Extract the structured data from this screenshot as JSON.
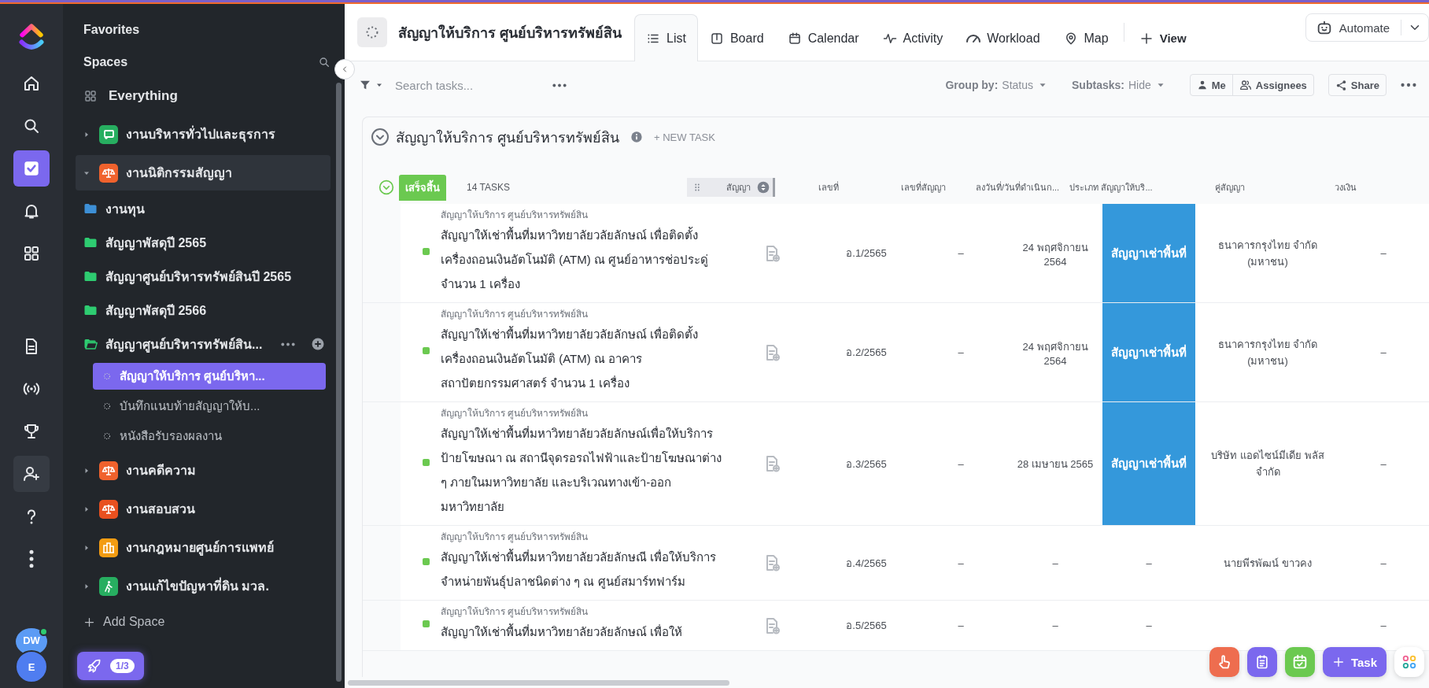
{
  "rail": {
    "items": [
      {
        "kind": "home",
        "selected": false,
        "hovered": false
      },
      {
        "kind": "search",
        "selected": false,
        "hovered": false
      },
      {
        "kind": "tasks",
        "selected": true,
        "hovered": false
      },
      {
        "kind": "bell",
        "selected": false,
        "hovered": false
      },
      {
        "kind": "grid",
        "selected": false,
        "hovered": false
      },
      {
        "kind": "gap"
      },
      {
        "kind": "doc",
        "selected": false,
        "hovered": false
      },
      {
        "kind": "pulse",
        "selected": false,
        "hovered": false
      },
      {
        "kind": "trophy",
        "selected": false,
        "hovered": false
      },
      {
        "kind": "invite",
        "selected": false,
        "hovered": true
      },
      {
        "kind": "help",
        "selected": false,
        "hovered": false
      },
      {
        "kind": "more",
        "selected": false,
        "hovered": false
      }
    ],
    "avatars": [
      {
        "initials": "DW",
        "online": true
      },
      {
        "initials": "E",
        "online": false
      }
    ]
  },
  "sidebar": {
    "favorites": "Favorites",
    "spaces_label": "Spaces",
    "everything": "Everything",
    "spaces": [
      {
        "label": "งานบริหารทั่วไปและธุรการ",
        "kind": "presentation",
        "color": "#27ae60",
        "expanded": false,
        "selected": false
      },
      {
        "label": "งานนิติกรรมสัญญา",
        "kind": "scale",
        "color": "#f0622d",
        "expanded": true,
        "selected": true,
        "children": [
          {
            "label": "งานทุน",
            "color": "#3d8fd6",
            "expanded": false
          },
          {
            "label": "สัญญาพัสดุปี 2565",
            "color": "#2ecc71",
            "expanded": false
          },
          {
            "label": "สัญญาศูนย์บริหารทรัพย์สินปี 2565",
            "color": "#2ecc71",
            "expanded": false
          },
          {
            "label": "สัญญาพัสดุปี 2566",
            "color": "#2ecc71",
            "expanded": false
          },
          {
            "label": "สัญญาศูนย์บริหารทรัพย์สิน...",
            "color": "#2ecc71",
            "expanded": true,
            "children": [
              {
                "label": "สัญญาให้บริการ ศูนย์บริหา...",
                "selected": true
              },
              {
                "label": "บันทึกแนบท้ายสัญญาให้บ...",
                "selected": false
              },
              {
                "label": "หนังสือรับรองผลงาน",
                "selected": false
              }
            ]
          }
        ]
      },
      {
        "label": "งานคดีความ",
        "kind": "scale",
        "color": "#f0622d",
        "expanded": false,
        "selected": false
      },
      {
        "label": "งานสอบสวน",
        "kind": "scale",
        "color": "#e8501f",
        "expanded": false,
        "selected": false
      },
      {
        "label": "งานกฎหมายศูนย์การแพทย์",
        "kind": "building",
        "color": "#f39c12",
        "expanded": false,
        "selected": false
      },
      {
        "label": "งานแก้ไขปัญหาที่ดิน มวล.",
        "kind": "walker",
        "color": "#27ae60",
        "expanded": false,
        "selected": false
      }
    ],
    "add_space": "Add Space",
    "onboarding": "1/3"
  },
  "header": {
    "title": "สัญญาให้บริการ ศูนย์บริหารทรัพย์สิน",
    "tabs": [
      {
        "label": "List",
        "kind": "list",
        "selected": true
      },
      {
        "label": "Board",
        "kind": "board",
        "selected": false
      },
      {
        "label": "Calendar",
        "kind": "calendar",
        "selected": false
      },
      {
        "label": "Activity",
        "kind": "activity",
        "selected": false
      },
      {
        "label": "Workload",
        "kind": "gauge",
        "selected": false
      },
      {
        "label": "Map",
        "kind": "pin",
        "selected": false
      }
    ],
    "add_view": "View",
    "automate": "Automate"
  },
  "toolbar": {
    "search": {
      "placeholder": "Search tasks..."
    },
    "group_by": {
      "label": "Group by:",
      "value": "Status"
    },
    "subtasks": {
      "label": "Subtasks:",
      "value": "Hide"
    },
    "me": "Me",
    "assignees": "Assignees",
    "share": "Share"
  },
  "list": {
    "title": "สัญญาให้บริการ ศูนย์บริหารทรัพย์สิน",
    "new_task": "+ NEW TASK",
    "group": {
      "status": "เสร็จสิ้น",
      "color": "#6bc950",
      "count": "14 TASKS",
      "expanded": true
    },
    "columns": [
      {
        "label": "สัญญา",
        "sorted": true
      },
      {
        "label": "เลขที่",
        "sorted": false
      },
      {
        "label": "เลขที่สัญญา",
        "sorted": false
      },
      {
        "label": "ลงวันที่/วันที่ดำเนินก...",
        "sorted": false
      },
      {
        "label": "ประเภท สัญญาให้บริ...",
        "sorted": false
      },
      {
        "label": "คู่สัญญา",
        "sorted": false
      },
      {
        "label": "วงเงิน",
        "sorted": false
      }
    ],
    "rows": [
      {
        "breadcrumb": "สัญญาให้บริการ ศูนย์บริหารทรัพย์สิน",
        "title": "สัญญาให้เช่าพื้นที่มหาวิทยาลัยวลัยลักษณ์ เพื่อติดตั้งเครื่องถอนเงินอัตโนมัติ (ATM) ณ ศูนย์อาหารช่อประดู่ จำนวน 1 เครื่อง",
        "number": "อ.1/2565",
        "contract_no": "–",
        "date": "24 พฤศจิกายน 2564",
        "type": {
          "kind": "tag",
          "text": "สัญญาเช่าพื้นที่",
          "color": "#3498db"
        },
        "party": "ธนาคารกรุงไทย จำกัด (มหาชน)",
        "amount": "–"
      },
      {
        "breadcrumb": "สัญญาให้บริการ ศูนย์บริหารทรัพย์สิน",
        "title": "สัญญาให้เช่าพื้นที่มหาวิทยาลัยวลัยลักษณ์ เพื่อติดตั้งเครื่องถอนเงินอัตโนมัติ (ATM) ณ อาคาร สถาปัตยกรรมศาสตร์ จำนวน 1 เครื่อง",
        "number": "อ.2/2565",
        "contract_no": "–",
        "date": "24 พฤศจิกายน 2564",
        "type": {
          "kind": "tag",
          "text": "สัญญาเช่าพื้นที่",
          "color": "#3498db"
        },
        "party": "ธนาคารกรุงไทย จำกัด (มหาชน)",
        "amount": "–"
      },
      {
        "breadcrumb": "สัญญาให้บริการ ศูนย์บริหารทรัพย์สิน",
        "title": "สัญญาให้เช่าพื้นที่มหาวิทยาลัยวลัยลักษณ์เพื่อให้บริการป้ายโฆษณา ณ สถานีจุดรอรถไฟฟ้าและป้ายโฆษณาต่าง ๆ ภายในมหาวิทยาลัย และบริเวณทางเข้า-ออกมหาวิทยาลัย",
        "number": "อ.3/2565",
        "contract_no": "–",
        "date": "28 เมษายน 2565",
        "type": {
          "kind": "tag",
          "text": "สัญญาเช่าพื้นที่",
          "color": "#3498db"
        },
        "party": "บริษัท แอดไซน์มีเดีย พลัส จำกัด",
        "amount": "–"
      },
      {
        "breadcrumb": "สัญญาให้บริการ ศูนย์บริหารทรัพย์สิน",
        "title": "สัญญาให้เช่าพื้นที่มหาวิทยาลัยวลัยลักษณี เพื่อให้บริการจำหน่ายพันธุ์ปลาชนิดต่าง ๆ ณ ศูนย์สมาร์ทฟาร์ม",
        "number": "อ.4/2565",
        "contract_no": "–",
        "date": "–",
        "type": {
          "kind": "empty",
          "text": "–"
        },
        "party": "นายพีรพัฒน์ ขาวคง",
        "amount": "–"
      },
      {
        "breadcrumb": "สัญญาให้บริการ ศูนย์บริหารทรัพย์สิน",
        "title": "สัญญาให้เช่าพื้นที่มหาวิทยาลัยวลัยลักษณ์ เพื่อให้",
        "number": "อ.5/2565",
        "contract_no": "–",
        "date": "–",
        "type": {
          "kind": "empty",
          "text": "–"
        },
        "amount": "–"
      }
    ]
  },
  "quick_actions": {
    "task": "Task"
  }
}
